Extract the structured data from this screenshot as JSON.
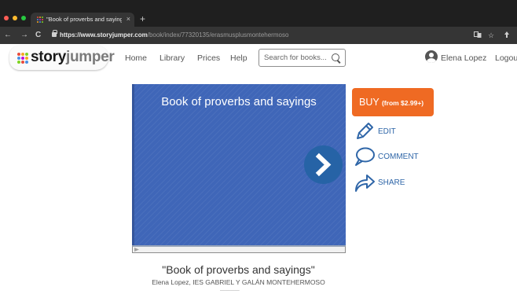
{
  "browser": {
    "tab_title": "\"Book of proverbs and sayings\"",
    "tab_close": "×",
    "new_tab": "+",
    "back": "←",
    "forward": "→",
    "reload": "C",
    "url_host": "https://www.storyjumper.com",
    "url_path": "/book/index/77320135/erasmusplusmontehermoso",
    "star": "☆"
  },
  "site": {
    "logo_story": "story",
    "logo_jumper": "jumper",
    "nav": [
      "Home",
      "Library",
      "Prices",
      "Help"
    ],
    "search_placeholder": "Search for books...",
    "user_name": "Elena Lopez",
    "logout": "Logout"
  },
  "book": {
    "title": "Book of proverbs and sayings",
    "caption_title": "\"Book of proverbs and sayings\"",
    "caption_authors": "Elena Lopez, IES GABRIEL Y GALÁN MONTEHERMOSO"
  },
  "actions": {
    "buy_label": "BUY",
    "buy_price": "(from $2.99+)",
    "edit": "EDIT",
    "comment": "COMMENT",
    "share": "SHARE"
  },
  "colors": {
    "buy": "#ef6a23",
    "book_cover": "#3f66b8",
    "action_link": "#2f66a8",
    "next_button": "#2663a6"
  }
}
